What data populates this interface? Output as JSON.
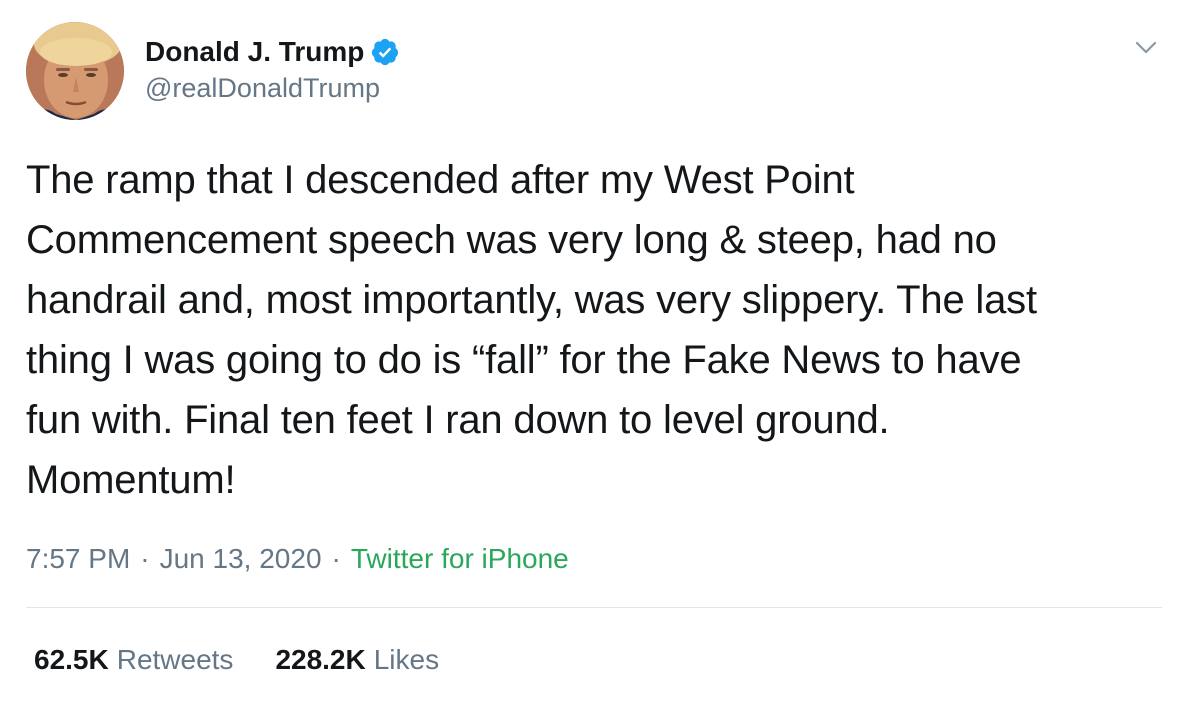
{
  "user": {
    "display_name": "Donald J. Trump",
    "handle": "@realDonaldTrump",
    "verified": true,
    "verified_color": "#1da1f2"
  },
  "tweet": {
    "text": "The ramp that I descended after my West Point\nCommencement speech was very long & steep, had no\nhandrail and, most importantly, was very slippery. The last\nthing I was going to do is “fall” for the Fake News to have\nfun with. Final ten feet I ran down to level ground.\nMomentum!",
    "time": "7:57 PM",
    "date": "Jun 13, 2020",
    "source": "Twitter for iPhone",
    "separator": "·"
  },
  "stats": {
    "retweets_count": "62.5K",
    "retweets_label": "Retweets",
    "likes_count": "228.2K",
    "likes_label": "Likes"
  },
  "icons": {
    "more": "chevron-down-icon",
    "verified": "verified-badge-icon"
  },
  "colors": {
    "source_link": "#2aa85a",
    "secondary_text": "#657786",
    "primary_text": "#14171a"
  }
}
